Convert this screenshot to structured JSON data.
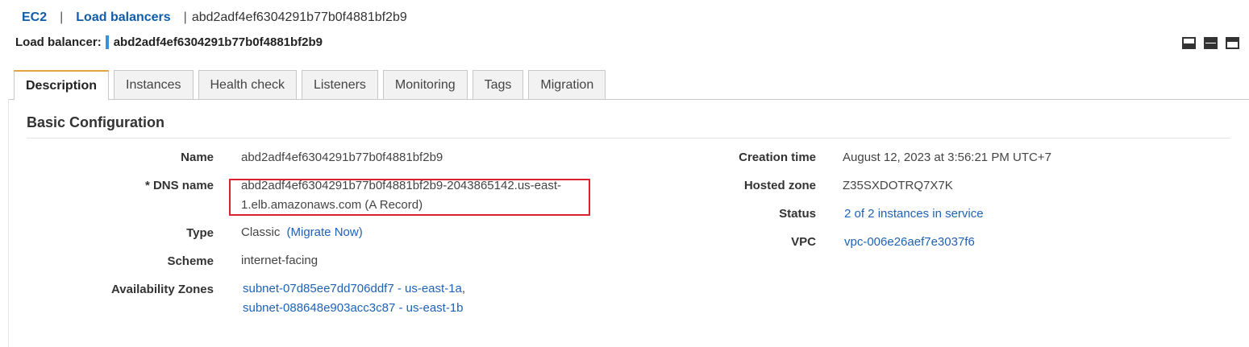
{
  "breadcrumb": {
    "ec2": "EC2",
    "separator": "|",
    "load_balancers": "Load balancers",
    "current": "abd2adf4ef6304291b77b0f4881bf2b9"
  },
  "header": {
    "label": "Load balancer:",
    "name": "abd2adf4ef6304291b77b0f4881bf2b9"
  },
  "layout_controls": [
    "panel-bottom-icon",
    "panel-split-icon",
    "panel-top-icon"
  ],
  "tabs": [
    {
      "label": "Description",
      "active": true
    },
    {
      "label": "Instances"
    },
    {
      "label": "Health check"
    },
    {
      "label": "Listeners"
    },
    {
      "label": "Monitoring"
    },
    {
      "label": "Tags"
    },
    {
      "label": "Migration"
    }
  ],
  "section": {
    "title": "Basic Configuration"
  },
  "left": {
    "name_label": "Name",
    "name_value": "abd2adf4ef6304291b77b0f4881bf2b9",
    "dns_label": "* DNS name",
    "dns_line1": "abd2adf4ef6304291b77b0f4881bf2b9-2043865142.us-east-",
    "dns_line2": "1.elb.amazonaws.com (A Record)",
    "type_label": "Type",
    "type_value": "Classic",
    "type_link": "(Migrate Now)",
    "scheme_label": "Scheme",
    "scheme_value": "internet-facing",
    "az_label": "Availability Zones",
    "az_1": "subnet-07d85ee7dd706ddf7 - us-east-1a",
    "az_comma": ",",
    "az_2": "subnet-088648e903acc3c87 - us-east-1b"
  },
  "right": {
    "creation_label": "Creation time",
    "creation_value": "August 12, 2023 at 3:56:21 PM UTC+7",
    "zone_label": "Hosted zone",
    "zone_value": "Z35SXDOTRQ7X7K",
    "status_label": "Status",
    "status_value": "2 of 2 instances in service",
    "vpc_label": "VPC",
    "vpc_value": "vpc-006e26aef7e3037f6"
  },
  "colors": {
    "link": "#1f62b5",
    "active_tab_accent": "#e7a33e",
    "highlight_box": "#d9232e",
    "marker": "#3f8ed8"
  }
}
